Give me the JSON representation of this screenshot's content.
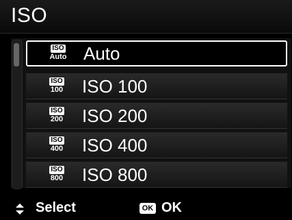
{
  "header": {
    "title": "ISO"
  },
  "menu": {
    "items": [
      {
        "label": "Auto",
        "icon_top": "ISO",
        "icon_bottom": "Auto",
        "icon": "iso-auto-icon",
        "selected": true
      },
      {
        "label": "ISO 100",
        "icon_top": "ISO",
        "icon_bottom": "100",
        "icon": "iso-100-icon",
        "selected": false
      },
      {
        "label": "ISO 200",
        "icon_top": "ISO",
        "icon_bottom": "200",
        "icon": "iso-200-icon",
        "selected": false
      },
      {
        "label": "ISO 400",
        "icon_top": "ISO",
        "icon_bottom": "400",
        "icon": "iso-400-icon",
        "selected": false
      },
      {
        "label": "ISO 800",
        "icon_top": "ISO",
        "icon_bottom": "800",
        "icon": "iso-800-icon",
        "selected": false
      }
    ]
  },
  "footer": {
    "select_label": "Select",
    "ok_icon_text": "OK",
    "ok_label": "OK"
  },
  "colors": {
    "background": "#000000",
    "selection_border": "#ffffff",
    "text": "#ffffff"
  }
}
